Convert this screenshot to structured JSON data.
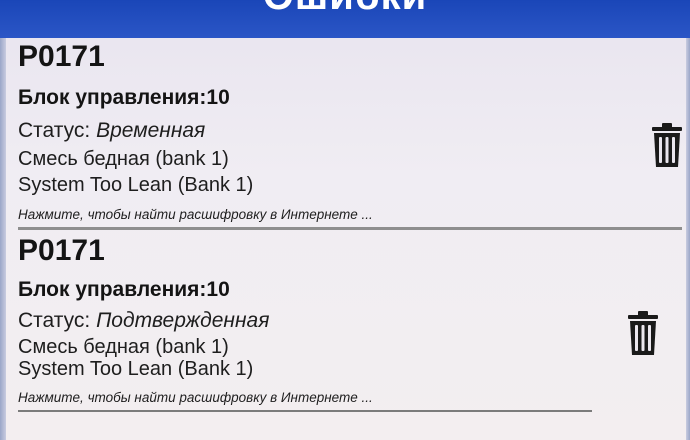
{
  "header": {
    "title": "Ошибки"
  },
  "dtc_list": [
    {
      "code": "P0171",
      "ecu_label": "Блок управления:10",
      "status_label": "Статус:",
      "status_value": "Временная",
      "description_ru": "Смесь бедная (bank 1)",
      "description_en": "System Too Lean (Bank 1)",
      "hint": "Нажмите, чтобы найти расшифровку в Интернете ...",
      "delete_icon": "trash-icon"
    },
    {
      "code": "P0171",
      "ecu_label": "Блок управления:10",
      "status_label": "Статус:",
      "status_value": "Подтвержденная",
      "description_ru": "Смесь бедная (bank 1)",
      "description_en": "System Too Lean (Bank 1)",
      "hint": "Нажмите, чтобы найти расшифровку в Интернете ...",
      "delete_icon": "trash-icon"
    }
  ],
  "colors": {
    "header_bg": "#1f4dbd",
    "text": "#141414",
    "divider": "#8e8e8e",
    "background": "#ece8f0"
  }
}
